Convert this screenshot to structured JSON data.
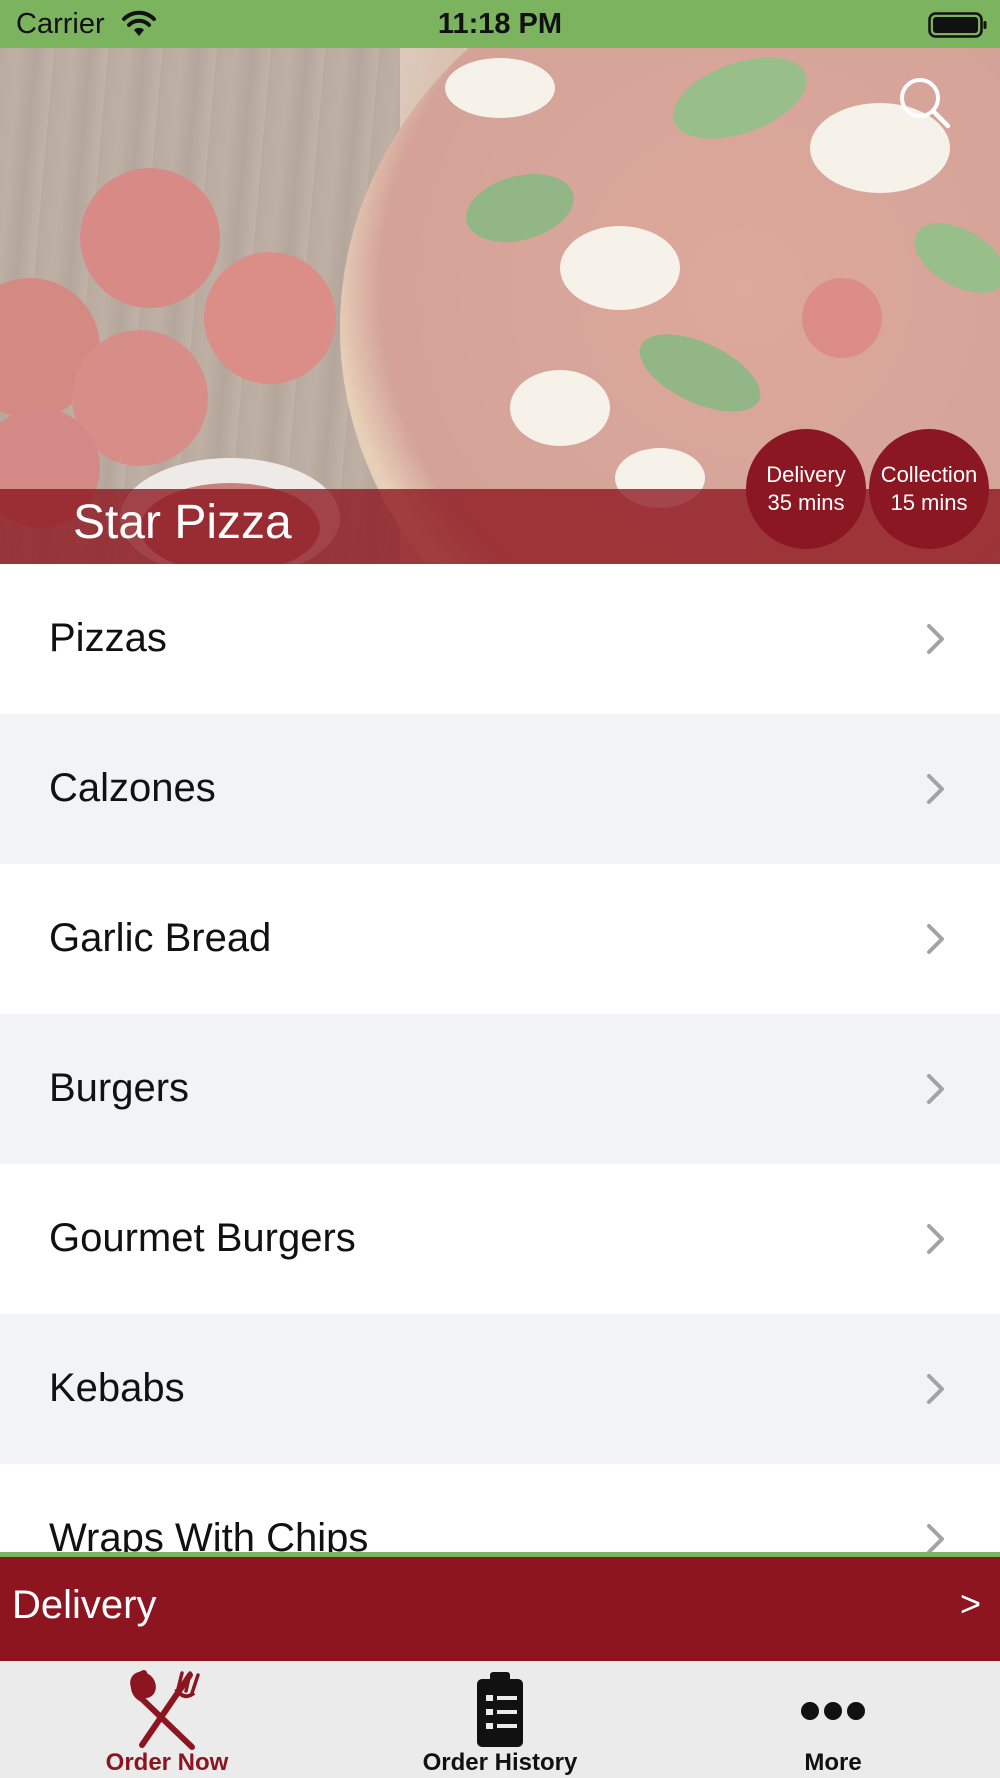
{
  "status_bar": {
    "carrier": "Carrier",
    "time": "11:18 PM"
  },
  "hero": {
    "shop_name": "Star Pizza",
    "delivery_badge": {
      "line1": "Delivery",
      "line2": "35 mins"
    },
    "collection_badge": {
      "line1": "Collection",
      "line2": "15 mins"
    },
    "search_icon": "search-icon"
  },
  "menu": {
    "categories": [
      {
        "label": "Pizzas"
      },
      {
        "label": "Calzones"
      },
      {
        "label": "Garlic Bread"
      },
      {
        "label": "Burgers"
      },
      {
        "label": "Gourmet Burgers"
      },
      {
        "label": "Kebabs"
      },
      {
        "label": "Wraps With Chips"
      }
    ]
  },
  "order_bar": {
    "mode": "Delivery",
    "arrow": ">"
  },
  "tab_bar": {
    "tabs": [
      {
        "label": "Order Now",
        "icon": "fork-knife-icon",
        "active": true
      },
      {
        "label": "Order History",
        "icon": "clipboard-icon",
        "active": false
      },
      {
        "label": "More",
        "icon": "more-dots-icon",
        "active": false
      }
    ]
  },
  "colors": {
    "brand_red": "#8c1520",
    "accent_green": "#7cb35e",
    "tab_bar_bg": "#ebebeb"
  }
}
